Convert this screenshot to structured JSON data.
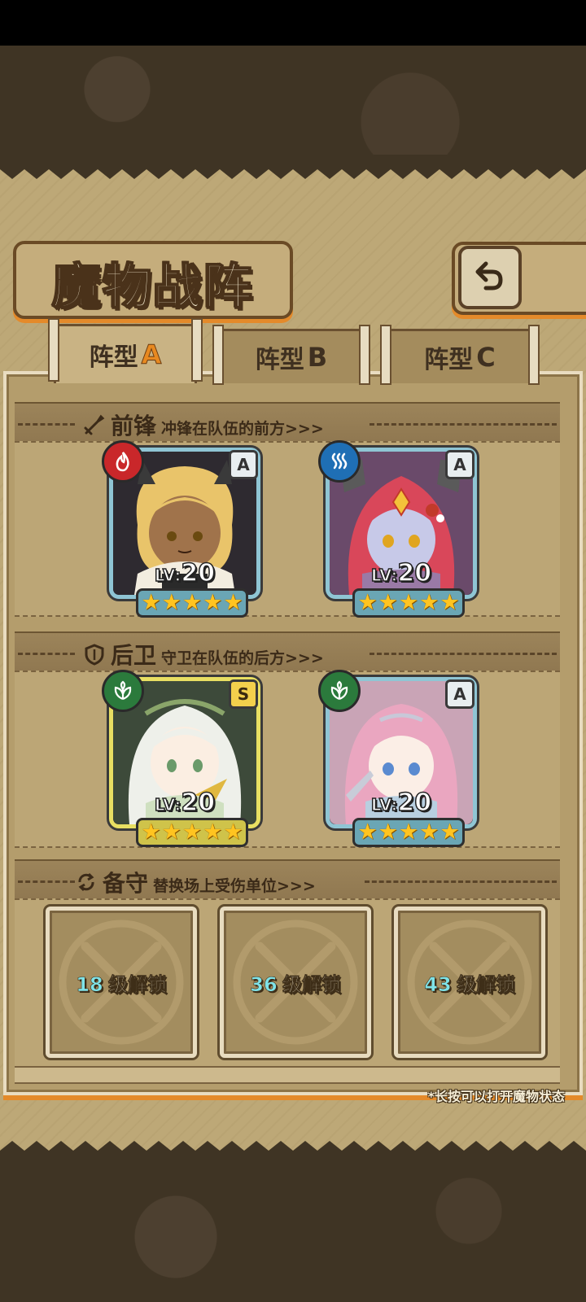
{
  "colors": {
    "parchment": "#bda877",
    "frame_brown": "#6a4a25",
    "accent_orange": "#e48a2a",
    "card_border_blue": "#8fc5d4",
    "card_border_gold": "#e8df62",
    "fire_element": "#c9272a",
    "water_element": "#1f6fb5",
    "wind_element": "#2b7a3c",
    "unlock_level_cyan": "#7fe3e8"
  },
  "header": {
    "title": "魔物战阵",
    "back_icon": "return-arrow-icon"
  },
  "tabs": [
    {
      "prefix": "阵型",
      "letter": "A",
      "active": true
    },
    {
      "prefix": "阵型",
      "letter": "B",
      "active": false
    },
    {
      "prefix": "阵型",
      "letter": "C",
      "active": false
    }
  ],
  "sections": {
    "front": {
      "icon": "sword-icon",
      "name": "前锋",
      "desc": "冲锋在队伍的前方>>>"
    },
    "back": {
      "icon": "shield-icon",
      "name": "后卫",
      "desc": "守卫在队伍的后方>>>"
    },
    "reserve": {
      "icon": "swap-icon",
      "name": "备守",
      "desc": "替换场上受伤单位>>>"
    }
  },
  "monsters": [
    {
      "slot": "front-1",
      "element": "fire",
      "element_icon": "flame-icon",
      "rank": "A",
      "level_prefix": "LV:",
      "level": "20",
      "stars": 5
    },
    {
      "slot": "front-2",
      "element": "water",
      "element_icon": "water-waves-icon",
      "rank": "A",
      "level_prefix": "LV:",
      "level": "20",
      "stars": 5
    },
    {
      "slot": "back-1",
      "element": "wind",
      "element_icon": "leaf-icon",
      "rank": "S",
      "level_prefix": "LV:",
      "level": "20",
      "stars": 5
    },
    {
      "slot": "back-2",
      "element": "wind",
      "element_icon": "leaf-icon",
      "rank": "A",
      "level_prefix": "LV:",
      "level": "20",
      "stars": 5
    }
  ],
  "reserve_slots": [
    {
      "level": "18",
      "unlock_text": "级解锁"
    },
    {
      "level": "36",
      "unlock_text": "级解锁"
    },
    {
      "level": "43",
      "unlock_text": "级解锁"
    }
  ],
  "footnote": "*长按可以打开魔物状态"
}
